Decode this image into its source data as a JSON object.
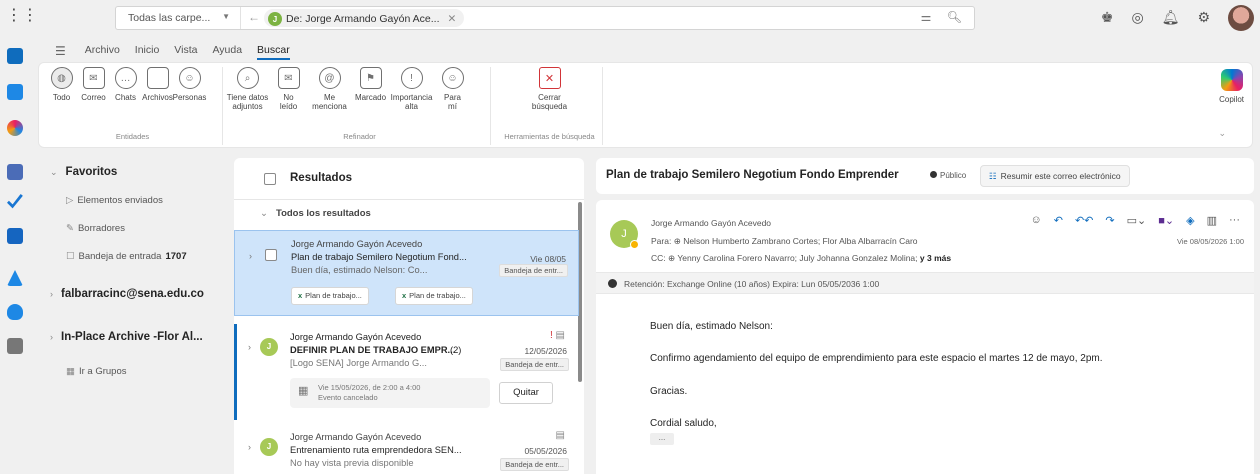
{
  "search": {
    "scope": "Todas las carpe...",
    "chip": "De: Jorge Armando Gayón Ace...",
    "chip_initial": "J"
  },
  "tabs": [
    "Archivo",
    "Inicio",
    "Vista",
    "Ayuda",
    "Buscar"
  ],
  "ribbon": {
    "group1": {
      "title": "Entidades",
      "buttons": [
        "Todo",
        "Correo",
        "Chats",
        "Archivos",
        "Personas"
      ]
    },
    "group2": {
      "title": "Refinador",
      "buttons": [
        {
          "l1": "Tiene datos",
          "l2": "adjuntos"
        },
        {
          "l1": "No",
          "l2": "leído"
        },
        {
          "l1": "Me",
          "l2": "menciona"
        },
        {
          "l1": "Marcado",
          "l2": ""
        },
        {
          "l1": "Importancia",
          "l2": "alta"
        },
        {
          "l1": "Para",
          "l2": "mí"
        }
      ]
    },
    "group3": {
      "title": "Herramientas de búsqueda",
      "close_l1": "Cerrar",
      "close_l2": "búsqueda"
    },
    "copilot": "Copilot"
  },
  "folders": {
    "favorites": "Favoritos",
    "sent": "Elementos enviados",
    "drafts": "Borradores",
    "inbox": "Bandeja de entrada",
    "inbox_count": "1707",
    "account": "falbarracinc@sena.edu.co",
    "archive": "In-Place Archive -Flor Al...",
    "groups": "Ir a Grupos"
  },
  "list": {
    "title": "Resultados",
    "section": "Todos los resultados",
    "messages": [
      {
        "sender": "Jorge Armando Gayón Acevedo",
        "subject": "Plan de trabajo Semilero Negotium Fond...",
        "date": "Vie 08/05",
        "preview": "Buen día, estimado Nelson: Co...",
        "tag": "Bandeja de entr...",
        "att1": "Plan de trabajo...",
        "att2": "Plan de trabajo..."
      },
      {
        "initial": "J",
        "sender": "Jorge Armando Gayón Acevedo",
        "subject": "DEFINIR PLAN DE TRABAJO EMPR...",
        "count": "(2)",
        "date": "12/05/2026",
        "preview": "[Logo SENA] Jorge Armando G...",
        "tag": "Bandeja de entr...",
        "event_l1": "Vie 15/05/2026, de 2:00 a 4:00",
        "event_l2": "Evento cancelado",
        "remove": "Quitar"
      },
      {
        "initial": "J",
        "sender": "Jorge Armando Gayón Acevedo",
        "subject": "Entrenamiento ruta emprendedora SEN...",
        "date": "05/05/2026",
        "preview": "No hay vista previa disponible",
        "tag": "Bandeja de entr..."
      }
    ]
  },
  "reading": {
    "subject": "Plan de trabajo Semilero Negotium  Fondo Emprender",
    "visibility": "Público",
    "summarize": "Resumir este correo electrónico",
    "initial": "J",
    "from": "Jorge Armando Gayón Acevedo",
    "to_label": "Para:",
    "to": "Nelson Humberto Zambrano Cortes;  Flor Alba Albarracín Caro",
    "cc_label": "CC:",
    "cc": "Yenny Carolina Forero Navarro;  July Johanna Gonzalez Molina;",
    "more": "y 3 más",
    "date": "Vie 08/05/2026 1:00",
    "retention": "Retención: Exchange Online (10 años) Expira: Lun 05/05/2036 1:00",
    "body": [
      "Buen día, estimado Nelson:",
      "Confirmo agendamiento del equipo de emprendimiento para este espacio el martes 12 de mayo, 2pm.",
      "Gracias.",
      "Cordial saludo,"
    ],
    "ellipsis": "..."
  },
  "colors": {
    "accent": "#0f6cbd",
    "selected_row": "#cfe4fa",
    "avatar": "#a7c957"
  }
}
